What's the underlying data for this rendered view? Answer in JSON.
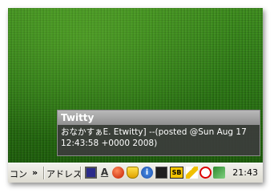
{
  "balloon": {
    "title": "Twitty",
    "line1": "おなかすぁE. Etwitty] --(posted @Sun Aug 17",
    "line2": "12:43:58 +0000 2008)"
  },
  "taskbar": {
    "left_fragment": "コン",
    "chevron": "»",
    "address_label": "アドレス",
    "clock": "21:43"
  },
  "tray_icons": [
    "monitor-icon",
    "font-a-icon",
    "red-ball-icon",
    "shield-icon",
    "info-icon",
    "messenger-icon",
    "sb-icon",
    "pencil-icon",
    "blocked-icon",
    "network-icon"
  ]
}
